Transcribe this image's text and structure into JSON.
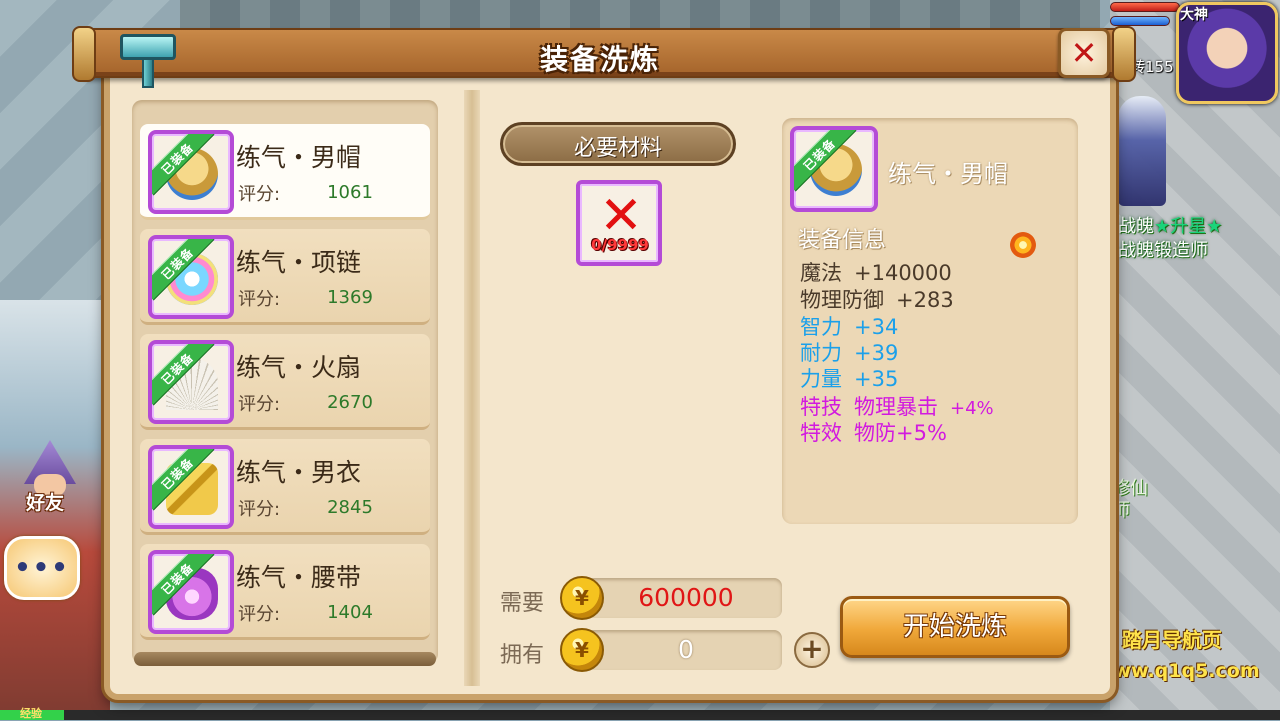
{
  "dialog": {
    "title": "装备洗炼",
    "close_glyph": "✕"
  },
  "equipment_list": [
    {
      "name": "练气・男帽",
      "score_label": "评分:",
      "score": "1061",
      "badge": "已装备",
      "selected": true,
      "icon": "hat-icon"
    },
    {
      "name": "练气・项链",
      "score_label": "评分:",
      "score": "1369",
      "badge": "已装备",
      "selected": false,
      "icon": "necklace-icon"
    },
    {
      "name": "练气・火扇",
      "score_label": "评分:",
      "score": "2670",
      "badge": "已装备",
      "selected": false,
      "icon": "fan-icon"
    },
    {
      "name": "练气・男衣",
      "score_label": "评分:",
      "score": "2845",
      "badge": "已装备",
      "selected": false,
      "icon": "robe-icon"
    },
    {
      "name": "练气・腰带",
      "score_label": "评分:",
      "score": "1404",
      "badge": "已装备",
      "selected": false,
      "icon": "belt-icon"
    }
  ],
  "materials": {
    "header": "必要材料",
    "count": "0/9999",
    "missing_glyph": "✕"
  },
  "detail": {
    "name": "练气・男帽",
    "badge": "已装备",
    "heading": "装备信息",
    "base_stats": [
      {
        "label": "魔法",
        "value": "+140000"
      },
      {
        "label": "物理防御",
        "value": "+283"
      }
    ],
    "bonus_stats": [
      {
        "label": "智力",
        "value": "+34"
      },
      {
        "label": "耐力",
        "value": "+39"
      },
      {
        "label": "力量",
        "value": "+35"
      }
    ],
    "special": [
      {
        "label": "特技",
        "value": "物理暴击",
        "extra": "+4%"
      },
      {
        "label": "特效",
        "value": "物防+5%",
        "extra": ""
      }
    ]
  },
  "cost": {
    "need_label": "需要",
    "need_value": "600000",
    "have_label": "拥有",
    "have_value": "0",
    "plus_glyph": "+",
    "start_button": "开始洗炼"
  },
  "hud": {
    "rebirth": "转155",
    "avatar_name": "大神",
    "friend_label": "好友",
    "chat_glyph": "•••",
    "npc_line1_a": "战魄",
    "npc_line1_b": "★升星★",
    "npc_line2": "战魄锻造师",
    "npc_line3": "修仙",
    "npc_line4": "师",
    "exp_label": "经验",
    "exp_fraction": 0.05
  },
  "watermark": {
    "line1": "踏月导航页",
    "line2": "www.q1q5.com"
  },
  "colors": {
    "frame_purple": "#b44bd6",
    "equipped_green": "#38b548",
    "score_green": "#2d7a2a",
    "stat_blue": "#1ba0ea",
    "stat_pink": "#d21adf",
    "need_red": "#e01616"
  }
}
